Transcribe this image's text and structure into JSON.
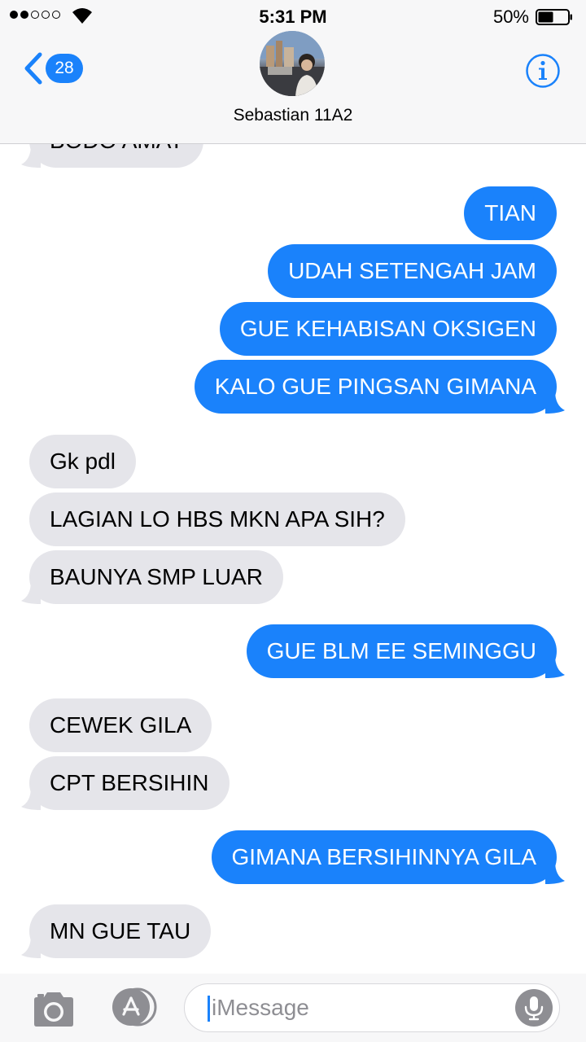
{
  "status_bar": {
    "time": "5:31 PM",
    "battery_percent": "50%",
    "signal_bars_filled": 2,
    "signal_bars_total": 5,
    "battery_level": 0.5
  },
  "header": {
    "back_badge_count": "28",
    "contact_name": "Sebastian 11A2",
    "info_icon": "info-circle-icon",
    "back_icon": "chevron-left-icon"
  },
  "messages": [
    {
      "direction": "in",
      "text": "BODO AMAT"
    },
    {
      "direction": "out",
      "text": "TIAN"
    },
    {
      "direction": "out",
      "text": "UDAH SETENGAH JAM"
    },
    {
      "direction": "out",
      "text": "GUE KEHABISAN OKSIGEN"
    },
    {
      "direction": "out",
      "text": "KALO GUE PINGSAN GIMANA"
    },
    {
      "direction": "in",
      "text": "Gk pdl"
    },
    {
      "direction": "in",
      "text": "LAGIAN LO HBS MKN APA SIH?"
    },
    {
      "direction": "in",
      "text": "BAUNYA SMP LUAR"
    },
    {
      "direction": "out",
      "text": "GUE BLM EE SEMINGGU"
    },
    {
      "direction": "in",
      "text": "CEWEK GILA"
    },
    {
      "direction": "in",
      "text": "CPT BERSIHIN"
    },
    {
      "direction": "out",
      "text": "GIMANA BERSIHINNYA GILA"
    },
    {
      "direction": "in",
      "text": "MN GUE TAU"
    }
  ],
  "input_bar": {
    "placeholder": "iMessage",
    "camera_icon": "camera-icon",
    "apps_icon": "app-store-icon",
    "mic_icon": "microphone-icon"
  },
  "colors": {
    "outgoing_bubble": "#1a82fb",
    "incoming_bubble": "#e5e5ea",
    "accent": "#1a82fb",
    "header_bg": "#f7f7f8"
  }
}
